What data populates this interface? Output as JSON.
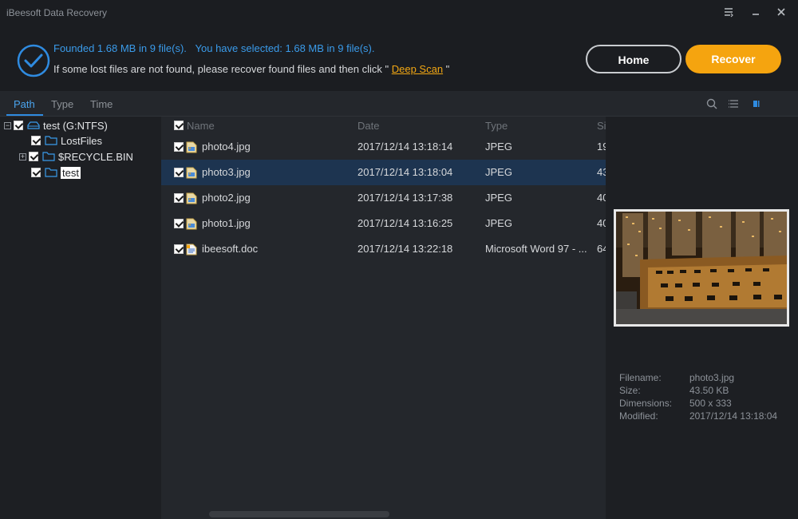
{
  "app": {
    "title": "iBeesoft Data Recovery"
  },
  "status": {
    "line1": "Founded 1.68 MB in 9 file(s).   You have selected: 1.68 MB in 9 file(s).",
    "line2_prefix": "If some lost files are not found, please recover found files and then click \" ",
    "deep_scan_link": "Deep Scan",
    "line2_suffix": " \""
  },
  "buttons": {
    "home": "Home",
    "recover": "Recover"
  },
  "tabs": [
    {
      "label": "Path"
    },
    {
      "label": "Type"
    },
    {
      "label": "Time"
    }
  ],
  "tree": {
    "root": "test (G:NTFS)",
    "children": [
      {
        "label": "LostFiles"
      },
      {
        "label": "$RECYCLE.BIN"
      },
      {
        "label": "test"
      }
    ]
  },
  "columns": {
    "name": "Name",
    "date": "Date",
    "type": "Type",
    "size": "Si"
  },
  "files": [
    {
      "name": "photo4.jpg",
      "date": "2017/12/14 13:18:14",
      "type": "JPEG",
      "size": "19"
    },
    {
      "name": "photo3.jpg",
      "date": "2017/12/14 13:18:04",
      "type": "JPEG",
      "size": "43"
    },
    {
      "name": "photo2.jpg",
      "date": "2017/12/14 13:17:38",
      "type": "JPEG",
      "size": "40"
    },
    {
      "name": "photo1.jpg",
      "date": "2017/12/14 13:16:25",
      "type": "JPEG",
      "size": "40"
    },
    {
      "name": "ibeesoft.doc",
      "date": "2017/12/14 13:22:18",
      "type": "Microsoft Word 97 - ...",
      "size": "64"
    }
  ],
  "preview": {
    "labels": {
      "filename": "Filename:",
      "size": "Size:",
      "dimensions": "Dimensions:",
      "modified": "Modified:"
    },
    "values": {
      "filename": "photo3.jpg",
      "size": "43.50 KB",
      "dimensions": "500 x 333",
      "modified": "2017/12/14 13:18:04"
    }
  },
  "colors": {
    "accent": "#2f8be0",
    "recover": "#f5a40f",
    "link": "#f2a713",
    "selected_row": "#1d3450"
  },
  "icons": [
    "menu-icon",
    "minimize-icon",
    "close-icon",
    "check-circle-icon",
    "search-icon",
    "list-view-icon",
    "grid-view-icon",
    "folder-icon",
    "drive-icon",
    "image-file-icon",
    "doc-file-icon"
  ]
}
